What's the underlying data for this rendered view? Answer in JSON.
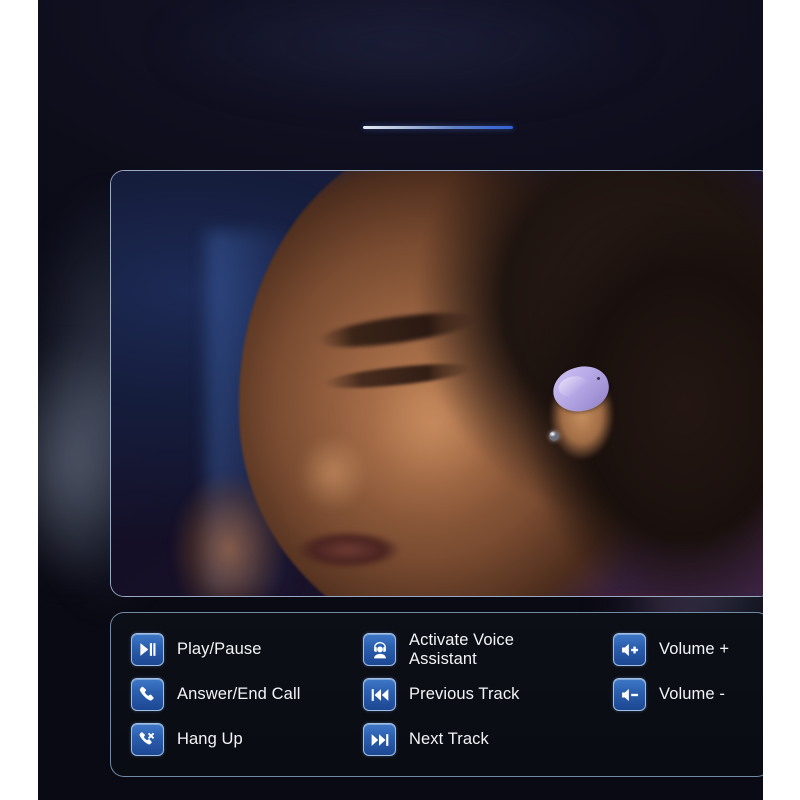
{
  "page": {
    "background_color": "#ffffff",
    "canvas_color": "#0b0b16",
    "accent_color": "#2f62d8",
    "tile_color": "#2b5fae",
    "tile_border_color": "#9fc0e4",
    "panel_border_color": "#96b4d7",
    "earbud_color": "#b6a8e6"
  },
  "divider": {
    "name": "accent-divider",
    "gradient_from": "#e6ecf4",
    "gradient_to": "#2f62d8"
  },
  "hero": {
    "alt": "Man wearing a lavender wireless earbud, eyes closed, purple and blue studio lighting",
    "earbud_color": "#b6a8e6"
  },
  "legend": {
    "columns": [
      [
        {
          "icon": "play-pause-icon",
          "label": "Play/Pause"
        },
        {
          "icon": "phone-answer-icon",
          "label": "Answer/End Call"
        },
        {
          "icon": "phone-hangup-icon",
          "label": "Hang Up"
        }
      ],
      [
        {
          "icon": "voice-assistant-icon",
          "label": "Activate Voice\nAssistant"
        },
        {
          "icon": "previous-track-icon",
          "label": "Previous Track"
        },
        {
          "icon": "next-track-icon",
          "label": "Next Track"
        }
      ],
      [
        {
          "icon": "volume-up-icon",
          "label": "Volume +"
        },
        {
          "icon": "volume-down-icon",
          "label": "Volume -"
        },
        {
          "icon": "",
          "label": ""
        }
      ]
    ]
  }
}
